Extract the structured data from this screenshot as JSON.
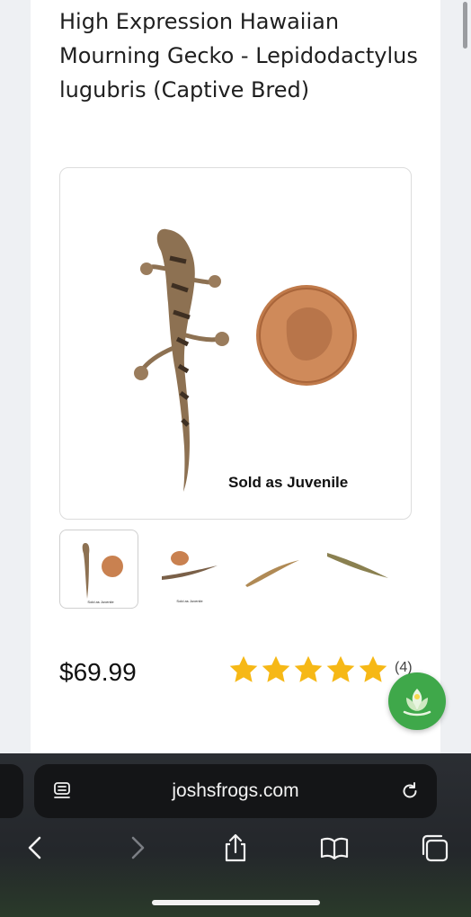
{
  "product": {
    "title": "High Expression Hawaiian Mourning Gecko - Lepidodactylus lugubris (Captive Bred)",
    "image_caption": "Sold as Juvenile",
    "thumb_caption": "Sold as Juvenile",
    "price": "$69.99",
    "rating": 5,
    "review_count": "(4)"
  },
  "browser": {
    "url": "joshsfrogs.com"
  },
  "colors": {
    "star": "#f6b816",
    "fab": "#3fa84a",
    "toolbar": "#24272b"
  },
  "icons": {
    "reader": "reader-icon",
    "reload": "reload-icon",
    "back": "chevron-left-icon",
    "forward": "chevron-right-icon",
    "share": "share-icon",
    "bookmarks": "book-icon",
    "tabs": "tabs-icon"
  }
}
